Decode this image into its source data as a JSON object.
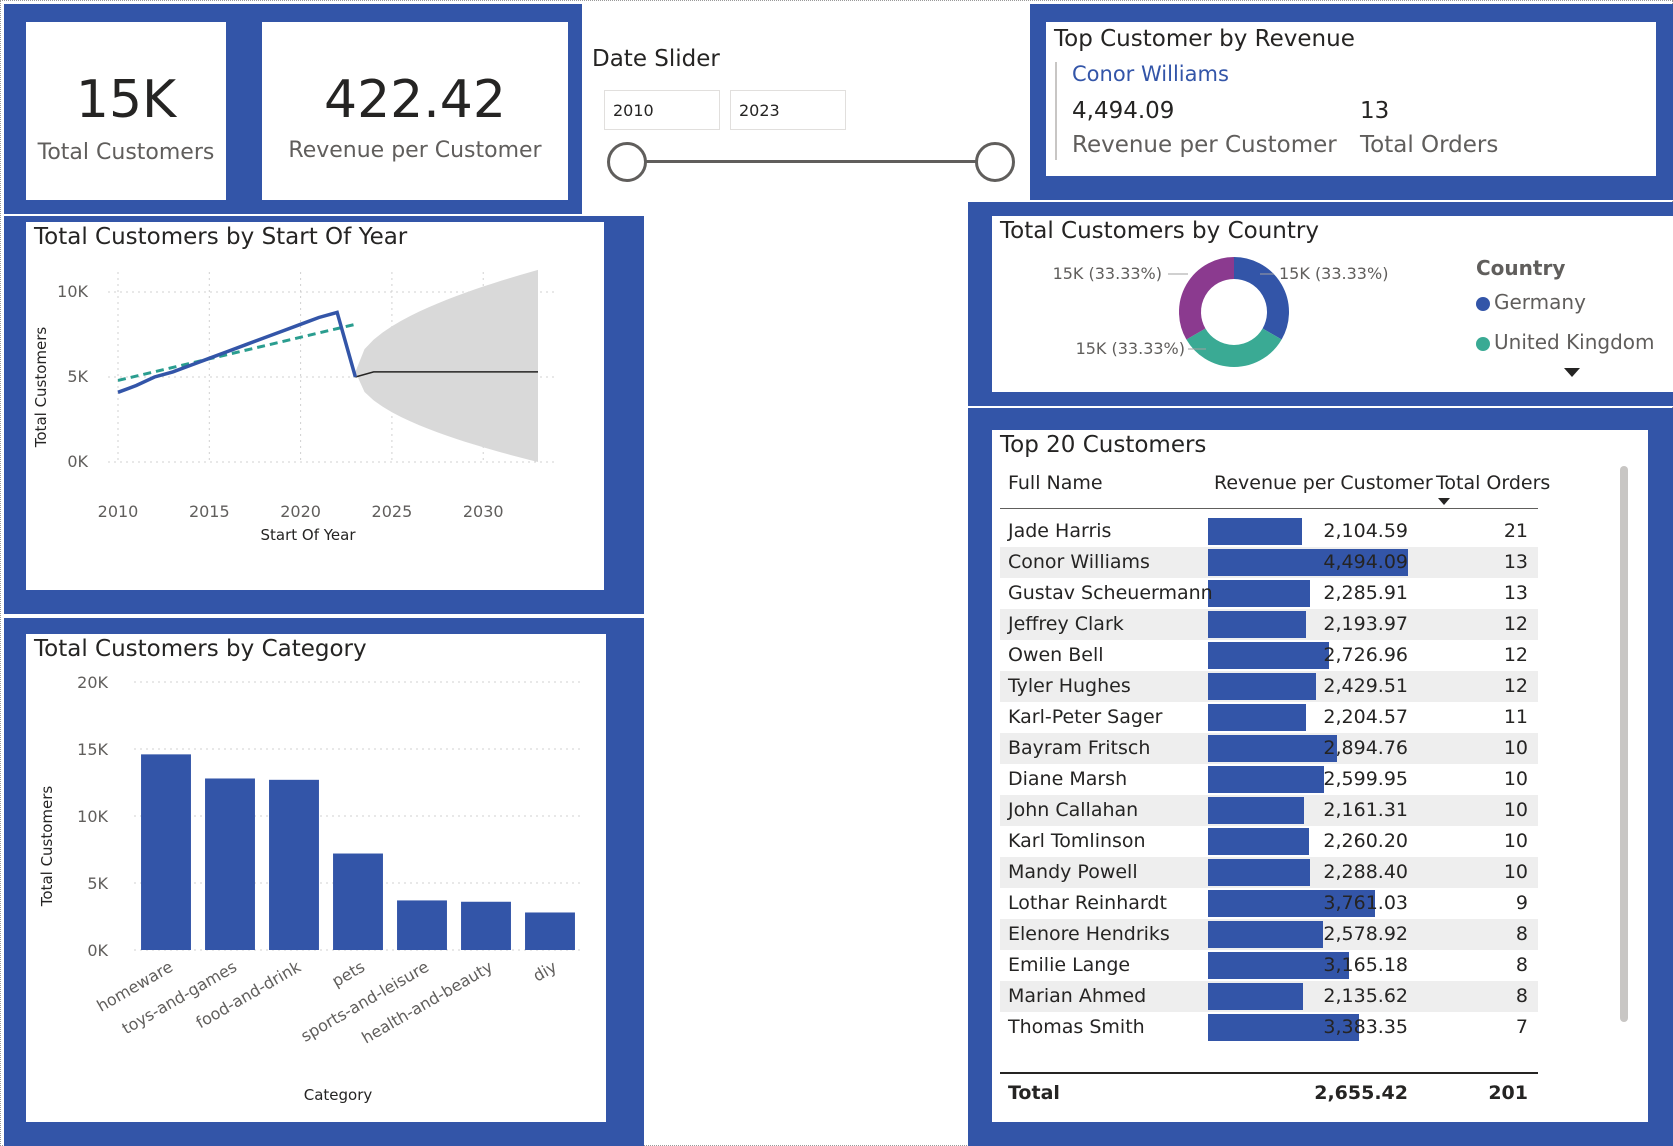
{
  "kpis": {
    "total_customers": {
      "value": "15K",
      "label": "Total Customers"
    },
    "revenue_per_customer": {
      "value": "422.42",
      "label": "Revenue per Customer"
    }
  },
  "date_slider": {
    "title": "Date Slider",
    "start": "2010",
    "end": "2023"
  },
  "top_customer": {
    "title": "Top Customer by Revenue",
    "name": "Conor Williams",
    "revenue_value": "4,494.09",
    "revenue_label": "Revenue per Customer",
    "orders_value": "13",
    "orders_label": "Total Orders"
  },
  "colors": {
    "accent": "#3355a8",
    "trend": "#2a9d8f",
    "donut_purple": "#8b3a8f",
    "donut_teal": "#3aaa94",
    "forecast": "#d9d9d9"
  },
  "chart_data": [
    {
      "type": "line",
      "title": "Total Customers by Start Of Year",
      "xlabel": "Start Of Year",
      "ylabel": "Total Customers",
      "x_ticks": [
        "2010",
        "2015",
        "2020",
        "2025",
        "2030"
      ],
      "y_ticks": [
        "0K",
        "5K",
        "10K"
      ],
      "xlim": [
        2010,
        2033
      ],
      "ylim": [
        0,
        10000
      ],
      "series": [
        {
          "x": [
            2010,
            2011,
            2012,
            2013,
            2014,
            2015,
            2016,
            2017,
            2018,
            2019,
            2020,
            2021,
            2022,
            2023
          ],
          "y": [
            4100,
            4500,
            5000,
            5300,
            5700,
            6100,
            6500,
            6900,
            7300,
            7700,
            8100,
            8500,
            8800,
            5000
          ]
        }
      ],
      "trend": {
        "x": [
          2010,
          2023
        ],
        "y": [
          4800,
          8100
        ]
      },
      "forecast": {
        "x_start": 2023,
        "x_end": 2033,
        "y": 5300,
        "upper_end": 11300,
        "lower_end": 0
      }
    },
    {
      "type": "pie",
      "title": "Total Customers by Country",
      "legend_title": "Country",
      "legend": [
        "Germany",
        "United Kingdom"
      ],
      "slices": [
        {
          "label": "15K (33.33%)",
          "value": 33.33
        },
        {
          "label": "15K (33.33%)",
          "value": 33.33
        },
        {
          "label": "15K (33.33%)",
          "value": 33.33
        }
      ]
    },
    {
      "type": "bar",
      "title": "Total Customers by Category",
      "xlabel": "Category",
      "ylabel": "Total Customers",
      "categories": [
        "homeware",
        "toys-and-games",
        "food-and-drink",
        "pets",
        "sports-and-leisure",
        "health-and-beauty",
        "diy"
      ],
      "values": [
        14600,
        12800,
        12700,
        7200,
        3700,
        3600,
        2800
      ],
      "y_ticks": [
        "0K",
        "5K",
        "10K",
        "15K",
        "20K"
      ],
      "ylim": [
        0,
        20000
      ]
    }
  ],
  "top20": {
    "title": "Top 20 Customers",
    "headers": {
      "name": "Full Name",
      "revenue": "Revenue per Customer",
      "orders": "Total Orders"
    },
    "rows": [
      {
        "name": "Jade Harris",
        "revenue": "2,104.59",
        "rev_num": 2104.59,
        "orders": "21"
      },
      {
        "name": "Conor Williams",
        "revenue": "4,494.09",
        "rev_num": 4494.09,
        "orders": "13"
      },
      {
        "name": "Gustav Scheuermann",
        "revenue": "2,285.91",
        "rev_num": 2285.91,
        "orders": "13"
      },
      {
        "name": "Jeffrey Clark",
        "revenue": "2,193.97",
        "rev_num": 2193.97,
        "orders": "12"
      },
      {
        "name": "Owen Bell",
        "revenue": "2,726.96",
        "rev_num": 2726.96,
        "orders": "12"
      },
      {
        "name": "Tyler Hughes",
        "revenue": "2,429.51",
        "rev_num": 2429.51,
        "orders": "12"
      },
      {
        "name": "Karl-Peter Sager",
        "revenue": "2,204.57",
        "rev_num": 2204.57,
        "orders": "11"
      },
      {
        "name": "Bayram Fritsch",
        "revenue": "2,894.76",
        "rev_num": 2894.76,
        "orders": "10"
      },
      {
        "name": "Diane Marsh",
        "revenue": "2,599.95",
        "rev_num": 2599.95,
        "orders": "10"
      },
      {
        "name": "John Callahan",
        "revenue": "2,161.31",
        "rev_num": 2161.31,
        "orders": "10"
      },
      {
        "name": "Karl Tomlinson",
        "revenue": "2,260.20",
        "rev_num": 2260.2,
        "orders": "10"
      },
      {
        "name": "Mandy Powell",
        "revenue": "2,288.40",
        "rev_num": 2288.4,
        "orders": "10"
      },
      {
        "name": "Lothar Reinhardt",
        "revenue": "3,761.03",
        "rev_num": 3761.03,
        "orders": "9"
      },
      {
        "name": "Elenore Hendriks",
        "revenue": "2,578.92",
        "rev_num": 2578.92,
        "orders": "8"
      },
      {
        "name": "Emilie Lange",
        "revenue": "3,165.18",
        "rev_num": 3165.18,
        "orders": "8"
      },
      {
        "name": "Marian Ahmed",
        "revenue": "2,135.62",
        "rev_num": 2135.62,
        "orders": "8"
      },
      {
        "name": "Thomas Smith",
        "revenue": "3,383.35",
        "rev_num": 3383.35,
        "orders": "7"
      }
    ],
    "total": {
      "label": "Total",
      "revenue": "2,655.42",
      "orders": "201"
    }
  }
}
